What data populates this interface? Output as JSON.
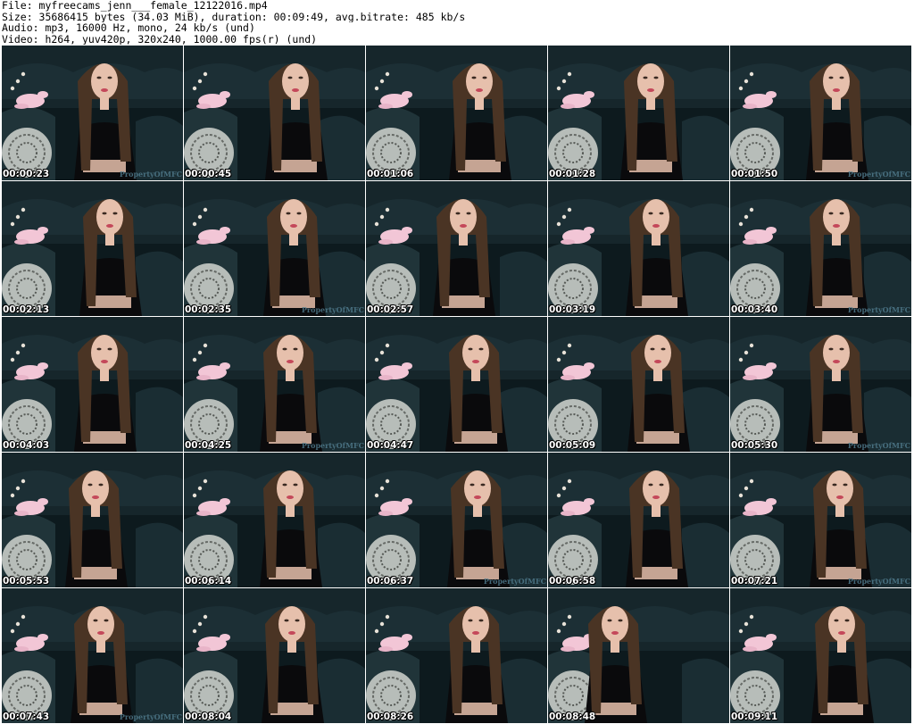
{
  "header": {
    "file_line": "File: myfreecams_jenn___female_12122016.mp4",
    "size_line": "Size: 35686415 bytes (34.03 MiB), duration: 00:09:49, avg.bitrate: 485 kb/s",
    "audio_line": "Audio: mp3, 16000 Hz, mono, 24 kb/s (und)",
    "video_line": "Video: h264, yuv420p, 320x240, 1000.00 fps(r) (und)"
  },
  "watermark_text": "PropertyOfMFC",
  "colors": {
    "background": "#ffffff",
    "frame_dark": "#0d1a1e",
    "sofa": "#16262b",
    "pillow": "#c8ccc8",
    "plush": "#f2c6d6",
    "hair": "#4a3424",
    "skin": "#e6c0ac",
    "shirt": "#0a0a0c",
    "watermark": "#4f7a8c"
  },
  "frames": [
    {
      "time": "00:00:23",
      "watermark": "PropertyOfMFC"
    },
    {
      "time": "00:00:45",
      "watermark": ""
    },
    {
      "time": "00:01:06",
      "watermark": ""
    },
    {
      "time": "00:01:28",
      "watermark": ""
    },
    {
      "time": "00:01:50",
      "watermark": "PropertyOfMFC"
    },
    {
      "time": "00:02:13",
      "watermark": ""
    },
    {
      "time": "00:02:35",
      "watermark": "PropertyOfMFC"
    },
    {
      "time": "00:02:57",
      "watermark": ""
    },
    {
      "time": "00:03:19",
      "watermark": ""
    },
    {
      "time": "00:03:40",
      "watermark": "PropertyOfMFC"
    },
    {
      "time": "00:04:03",
      "watermark": ""
    },
    {
      "time": "00:04:25",
      "watermark": "PropertyOfMFC"
    },
    {
      "time": "00:04:47",
      "watermark": ""
    },
    {
      "time": "00:05:09",
      "watermark": ""
    },
    {
      "time": "00:05:30",
      "watermark": "PropertyOfMFC"
    },
    {
      "time": "00:05:53",
      "watermark": ""
    },
    {
      "time": "00:06:14",
      "watermark": ""
    },
    {
      "time": "00:06:37",
      "watermark": "PropertyOfMFC"
    },
    {
      "time": "00:06:58",
      "watermark": ""
    },
    {
      "time": "00:07:21",
      "watermark": "PropertyOfMFC"
    },
    {
      "time": "00:07:43",
      "watermark": "PropertyOfMFC"
    },
    {
      "time": "00:08:04",
      "watermark": ""
    },
    {
      "time": "00:08:26",
      "watermark": ""
    },
    {
      "time": "00:08:48",
      "watermark": ""
    },
    {
      "time": "00:09:11",
      "watermark": ""
    }
  ]
}
